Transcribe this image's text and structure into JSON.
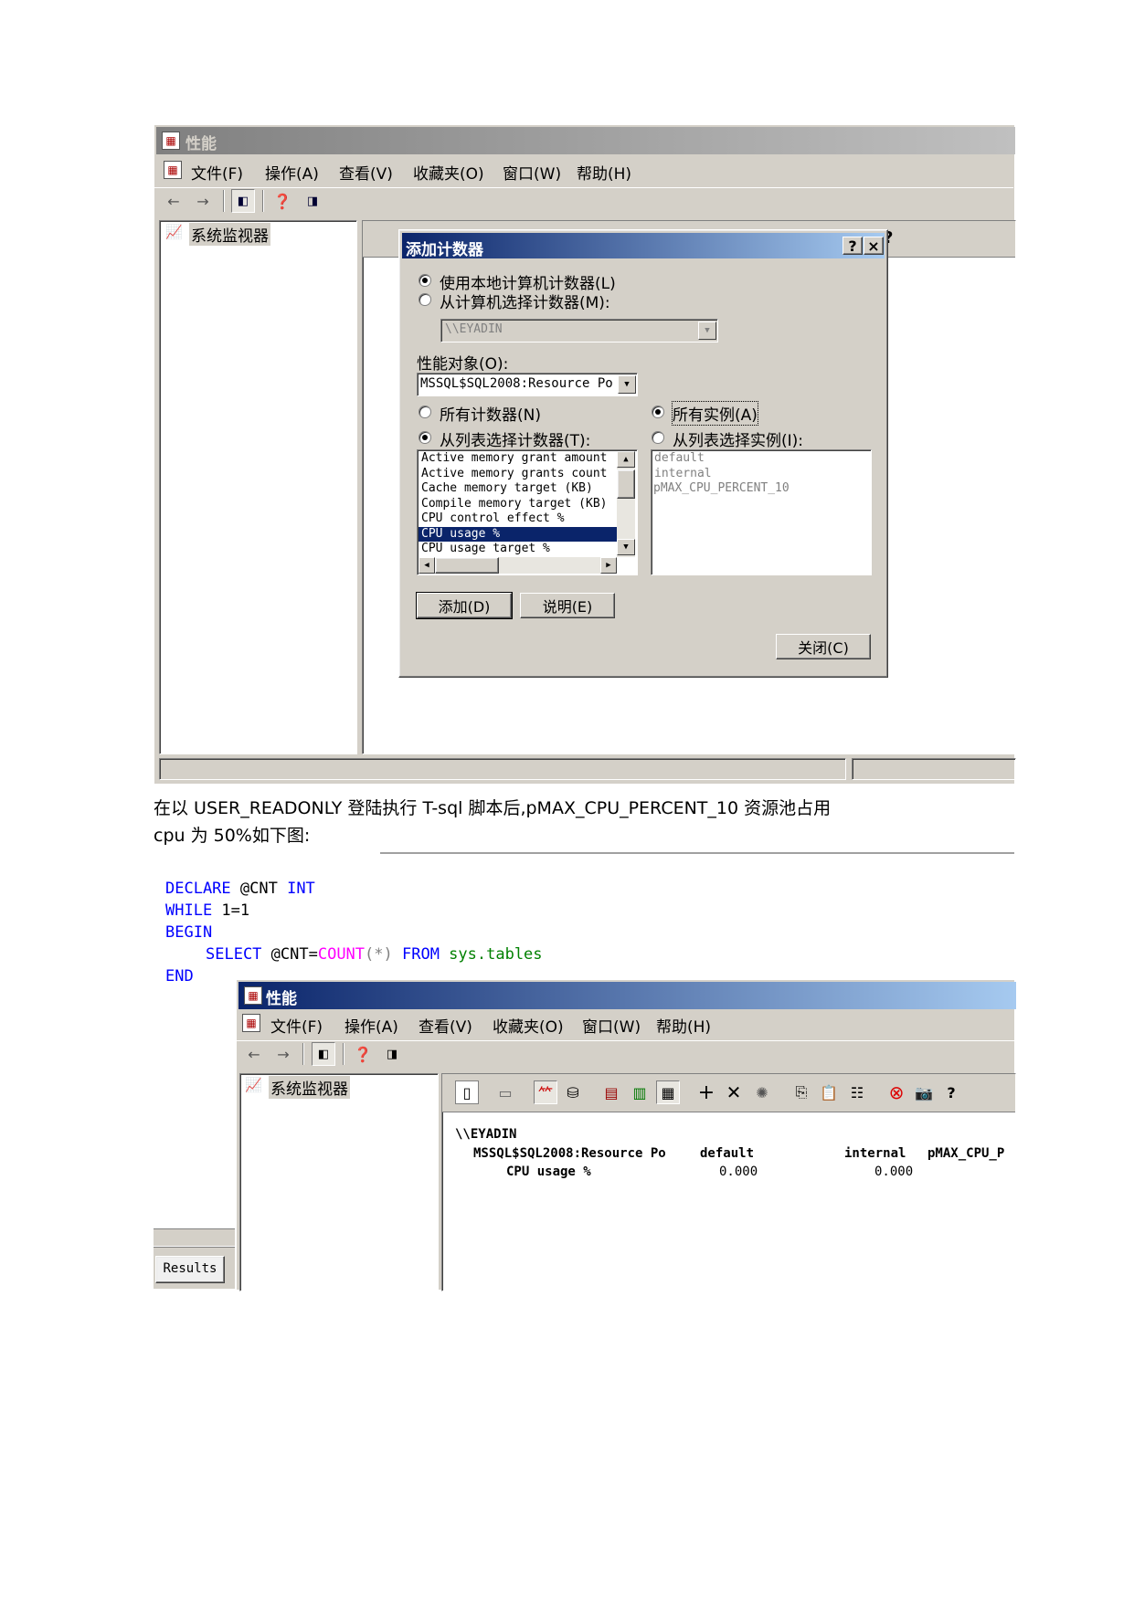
{
  "top_window": {
    "title": "性能",
    "menu": [
      "文件(F)",
      "操作(A)",
      "查看(V)",
      "收藏夹(O)",
      "窗口(W)",
      "帮助(H)"
    ],
    "tree_item": "系统监视器"
  },
  "dialog": {
    "title": "添加计数器",
    "help_glyph": "?",
    "close_glyph": "×",
    "radio_local": "使用本地计算机计数器(L)",
    "radio_select_machine": "从计算机选择计数器(M):",
    "machine_value": "\\\\EYADIN",
    "perf_object_label": "性能对象(O):",
    "perf_object_value": "MSSQL$SQL2008:Resource Po",
    "radio_all_counters": "所有计数器(N)",
    "radio_list_counters": "从列表选择计数器(T):",
    "radio_all_instances": "所有实例(A)",
    "radio_list_instances": "从列表选择实例(I):",
    "counters": [
      "Active memory grant amount",
      "Active memory grants count",
      "Cache memory target (KB)",
      "Compile memory target (KB)",
      "CPU control effect %",
      "CPU usage %",
      "CPU usage target %"
    ],
    "instances": [
      "default",
      "internal",
      "pMAX_CPU_PERCENT_10"
    ],
    "add_button": "添加(D)",
    "explain_button": "说明(E)",
    "close_button": "关闭(C)"
  },
  "paragraph": {
    "line1": "在以 USER_READONLY 登陆执行 T-sql 脚本后,pMAX_CPU_PERCENT_10 资源池占用",
    "line2": "cpu 为 50%如下图:"
  },
  "sql": {
    "l1_kw": "DECLARE",
    "l1_var": " @CNT ",
    "l1_type": "INT",
    "l2_kw": "WHILE",
    "l2_rest": " 1=1",
    "l3_kw": "BEGIN",
    "l4_kw": "SELECT",
    "l4_var": " @CNT=",
    "l4_fn": "COUNT",
    "l4_args": "(*)",
    "l4_from": " FROM",
    "l4_obj": " sys.tables",
    "l5_kw": "END"
  },
  "results_tab": "Results",
  "bottom_window": {
    "title": "性能",
    "menu": [
      "文件(F)",
      "操作(A)",
      "查看(V)",
      "收藏夹(O)",
      "窗口(W)",
      "帮助(H)"
    ],
    "tree_item": "系统监视器",
    "report": {
      "machine": "\\\\EYADIN",
      "object": "MSSQL$SQL2008:Resource Po",
      "col1": "default",
      "col2": "internal",
      "col3": "pMAX_CPU_P",
      "counter": "CPU usage %",
      "val1": "0.000",
      "val2": "0.000"
    }
  }
}
